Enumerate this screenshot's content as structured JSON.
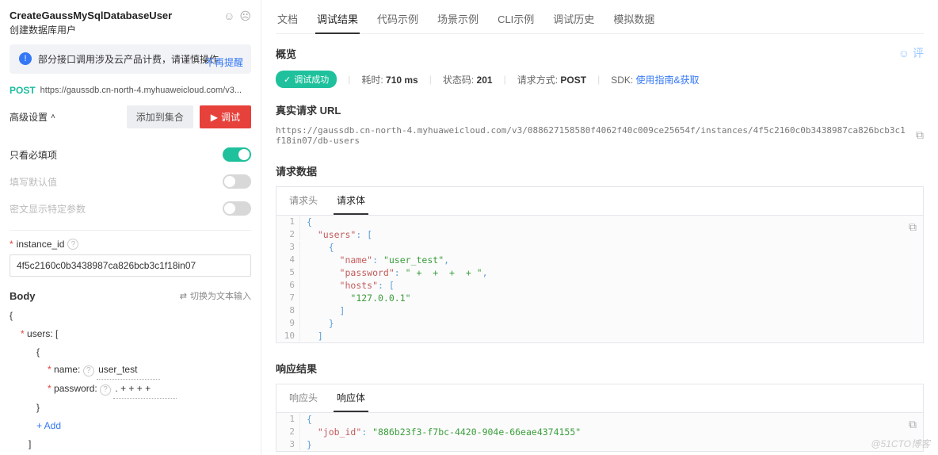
{
  "left": {
    "title": "CreateGaussMySqlDatabaseUser",
    "subtitle": "创建数据库用户",
    "warn": "部分接口调用涉及云产品计费，请谨慎操作",
    "warn_close": "不再提醒",
    "method": "POST",
    "url": "https://gaussdb.cn-north-4.myhuaweicloud.com/v3...",
    "adv": "高级设置",
    "btn_add": "添加到集合",
    "btn_debug": "调试",
    "options": [
      {
        "label": "只看必填项",
        "state": "on",
        "muted": false
      },
      {
        "label": "填写默认值",
        "state": "off",
        "muted": true
      },
      {
        "label": "密文显示特定参数",
        "state": "off",
        "muted": true
      }
    ],
    "field_label": "instance_id",
    "field_value": "4f5c2160c0b3438987ca826bcb3c1f18in07",
    "body_title": "Body",
    "switch_text": "切换为文本输入",
    "body_tree": {
      "users_key": "users: [",
      "name_key": "name:",
      "name_val": "user_test",
      "pwd_key": "password:",
      "pwd_val": ".   +   +   +   +",
      "add": "+ Add"
    }
  },
  "right": {
    "tabs": [
      "文档",
      "调试结果",
      "代码示例",
      "场景示例",
      "CLI示例",
      "调试历史",
      "模拟数据"
    ],
    "active_tab": 1,
    "overview": "概览",
    "comment": "评",
    "success": "调试成功",
    "time_label": "耗时:",
    "time_value": "710 ms",
    "code_label": "状态码:",
    "code_value": "201",
    "method_label": "请求方式:",
    "method_value": "POST",
    "sdk_label": "SDK:",
    "sdk_link": "使用指南&获取",
    "url_title": "真实请求 URL",
    "url_value": "https://gaussdb.cn-north-4.myhuaweicloud.com/v3/088627158580f4062f40c009ce25654f/instances/4f5c2160c0b3438987ca826bcb3c1f18in07/db-users",
    "req_title": "请求数据",
    "req_tabs": [
      "请求头",
      "请求体"
    ],
    "req_active": 1,
    "code_lines": [
      [
        {
          "c": "tok-b",
          "t": "{"
        }
      ],
      [
        {
          "c": "",
          "t": "  "
        },
        {
          "c": "tok-k",
          "t": "\"users\""
        },
        {
          "c": "tok-b",
          "t": ": ["
        }
      ],
      [
        {
          "c": "",
          "t": "    "
        },
        {
          "c": "tok-b",
          "t": "{"
        }
      ],
      [
        {
          "c": "",
          "t": "      "
        },
        {
          "c": "tok-k",
          "t": "\"name\""
        },
        {
          "c": "tok-b",
          "t": ": "
        },
        {
          "c": "tok-s",
          "t": "\"user_test\""
        },
        {
          "c": "tok-b",
          "t": ","
        }
      ],
      [
        {
          "c": "",
          "t": "      "
        },
        {
          "c": "tok-k",
          "t": "\"password\""
        },
        {
          "c": "tok-b",
          "t": ": "
        },
        {
          "c": "tok-s",
          "t": "\" +  +  +  + \""
        },
        {
          "c": "tok-b",
          "t": ","
        }
      ],
      [
        {
          "c": "",
          "t": "      "
        },
        {
          "c": "tok-k",
          "t": "\"hosts\""
        },
        {
          "c": "tok-b",
          "t": ": ["
        }
      ],
      [
        {
          "c": "",
          "t": "        "
        },
        {
          "c": "tok-s",
          "t": "\"127.0.0.1\""
        }
      ],
      [
        {
          "c": "",
          "t": "      "
        },
        {
          "c": "tok-b",
          "t": "]"
        }
      ],
      [
        {
          "c": "",
          "t": "    "
        },
        {
          "c": "tok-b",
          "t": "}"
        }
      ],
      [
        {
          "c": "",
          "t": "  "
        },
        {
          "c": "tok-b",
          "t": "]"
        }
      ]
    ],
    "resp_title": "响应结果",
    "resp_tabs": [
      "响应头",
      "响应体"
    ],
    "resp_active": 1,
    "resp_lines": [
      [
        {
          "c": "tok-b",
          "t": "{"
        }
      ],
      [
        {
          "c": "",
          "t": "  "
        },
        {
          "c": "tok-k",
          "t": "\"job_id\""
        },
        {
          "c": "tok-b",
          "t": ": "
        },
        {
          "c": "tok-s",
          "t": "\"886b23f3-f7bc-4420-904e-66eae4374155\""
        }
      ],
      [
        {
          "c": "tok-b",
          "t": "}"
        }
      ]
    ],
    "watermark": "@51CTO博客"
  }
}
